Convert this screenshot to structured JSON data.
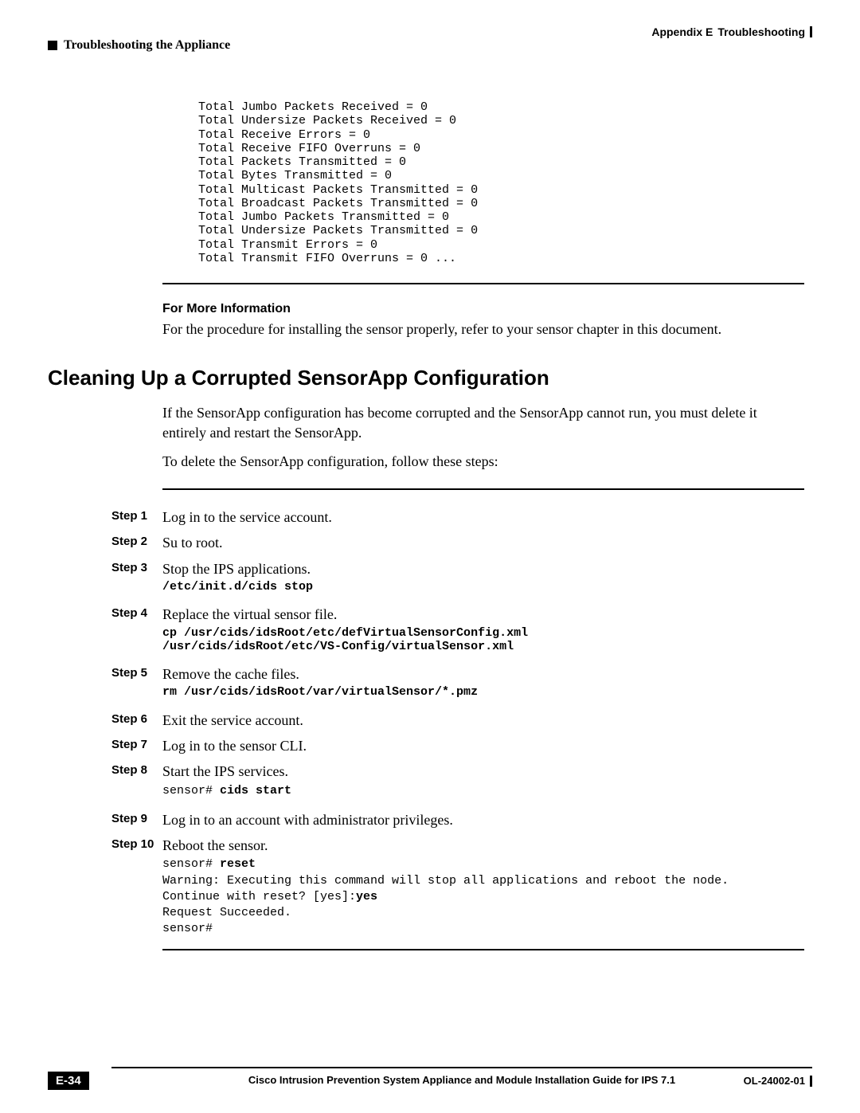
{
  "header": {
    "appendix_label": "Appendix E",
    "appendix_title": "Troubleshooting",
    "section_crumb": "Troubleshooting the Appliance"
  },
  "code_block_top": "     Total Jumbo Packets Received = 0\n     Total Undersize Packets Received = 0\n     Total Receive Errors = 0\n     Total Receive FIFO Overruns = 0\n     Total Packets Transmitted = 0\n     Total Bytes Transmitted = 0\n     Total Multicast Packets Transmitted = 0\n     Total Broadcast Packets Transmitted = 0\n     Total Jumbo Packets Transmitted = 0\n     Total Undersize Packets Transmitted = 0\n     Total Transmit Errors = 0\n     Total Transmit FIFO Overruns = 0 ...",
  "more_info": {
    "heading": "For More Information",
    "text": "For the procedure for installing the sensor properly, refer to your sensor chapter in this document."
  },
  "section": {
    "title": "Cleaning Up a Corrupted SensorApp Configuration",
    "intro1": "If the SensorApp configuration has become corrupted and the SensorApp cannot run, you must delete it entirely and restart the SensorApp.",
    "intro2": "To delete the SensorApp configuration, follow these steps:"
  },
  "steps": [
    {
      "label": "Step 1",
      "text": "Log in to the service account."
    },
    {
      "label": "Step 2",
      "text": "Su to root."
    },
    {
      "label": "Step 3",
      "text": "Stop the IPS applications.",
      "code_bold": "/etc/init.d/cids stop"
    },
    {
      "label": "Step 4",
      "text": "Replace the virtual sensor file.",
      "code_bold": "cp /usr/cids/idsRoot/etc/defVirtualSensorConfig.xml \n/usr/cids/idsRoot/etc/VS-Config/virtualSensor.xml"
    },
    {
      "label": "Step 5",
      "text": "Remove the cache files.",
      "code_bold": "rm /usr/cids/idsRoot/var/virtualSensor/*.pmz"
    },
    {
      "label": "Step 6",
      "text": "Exit the service account."
    },
    {
      "label": "Step 7",
      "text": "Log in to the sensor CLI."
    },
    {
      "label": "Step 8",
      "text": "Start the IPS services.",
      "console_prefix": "sensor# ",
      "console_bold": "cids start"
    },
    {
      "label": "Step 9",
      "text": "Log in to an account with administrator privileges."
    },
    {
      "label": "Step 10",
      "text": "Reboot the sensor.",
      "console_lines": [
        {
          "prefix": "sensor# ",
          "bold": "reset"
        },
        {
          "text": "Warning: Executing this command will stop all applications and reboot the node."
        },
        {
          "prefix": "Continue with reset? [yes]:",
          "bold": "yes"
        },
        {
          "text": "Request Succeeded."
        },
        {
          "text": "sensor#"
        }
      ]
    }
  ],
  "footer": {
    "doc_title": "Cisco Intrusion Prevention System Appliance and Module Installation Guide for IPS 7.1",
    "page_number": "E-34",
    "doc_id": "OL-24002-01"
  }
}
